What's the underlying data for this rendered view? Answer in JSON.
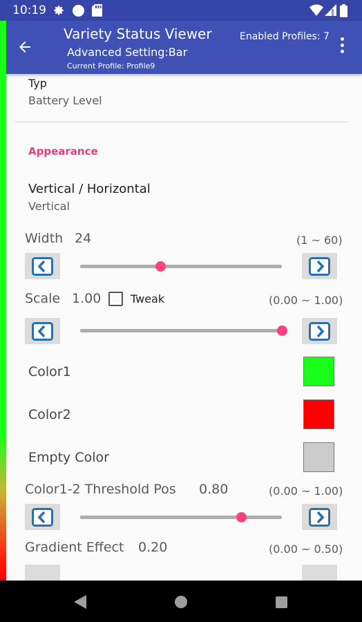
{
  "status_bar": {
    "time": "10:19",
    "left_icons": [
      "gear-icon",
      "circle-icon",
      "sd-card-icon"
    ],
    "right_icons": [
      "wifi-icon",
      "signal-icon",
      "battery-icon"
    ]
  },
  "app_bar": {
    "title": "Variety Status Viewer",
    "subtitle": "Advanced Setting:Bar",
    "current_profile": "Current Profile: Profile9",
    "enabled_profiles": "Enabled Profiles: 7"
  },
  "color_strip": {
    "colors": [
      "#1aff1a",
      "#c8b43a",
      "#ff0000"
    ]
  },
  "prefs": {
    "type_summary": "Battery Level",
    "appearance_header": "Appearance",
    "orientation_title": "Vertical / Horizontal",
    "orientation_summary": "Vertical"
  },
  "sliders": {
    "width": {
      "label": "Width",
      "value": "24",
      "range": "(1 ~ 60)",
      "fraction": 0.4
    },
    "scale": {
      "label": "Scale",
      "value": "1.00",
      "range": "(0.00 ~ 1.00)",
      "fraction": 1.0,
      "tweak_label": "Tweak",
      "tweak_checked": false
    },
    "threshold": {
      "label": "Color1-2 Threshold Pos",
      "value": "0.80",
      "range": "(0.00 ~ 1.00)",
      "fraction": 0.8
    },
    "gradient": {
      "label": "Gradient Effect",
      "value": "0.20",
      "range": "(0.00 ~ 0.50)",
      "fraction": 0.4
    }
  },
  "colors": {
    "color1": {
      "label": "Color1",
      "hex": "#1aff1a"
    },
    "color2": {
      "label": "Color2",
      "hex": "#ff0000"
    },
    "empty": {
      "label": "Empty Color",
      "hex": "#cccccc"
    }
  },
  "accent_color": "#ff4081",
  "primary_color": "#3f51b5"
}
